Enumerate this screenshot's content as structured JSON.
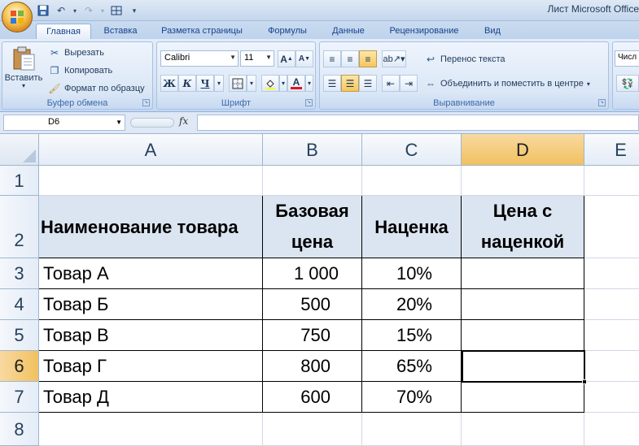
{
  "window": {
    "title": "Лист Microsoft Office"
  },
  "qat": {
    "save_icon": "save-icon",
    "undo_icon": "undo-icon",
    "redo_icon": "redo-icon"
  },
  "tabs": [
    {
      "label": "Главная",
      "active": true
    },
    {
      "label": "Вставка"
    },
    {
      "label": "Разметка страницы"
    },
    {
      "label": "Формулы"
    },
    {
      "label": "Данные"
    },
    {
      "label": "Рецензирование"
    },
    {
      "label": "Вид"
    }
  ],
  "ribbon": {
    "clipboard": {
      "label": "Буфер обмена",
      "paste": "Вставить",
      "cut": "Вырезать",
      "copy": "Копировать",
      "format_painter": "Формат по образцу"
    },
    "font": {
      "label": "Шрифт",
      "name": "Calibri",
      "size": "11",
      "bold": "Ж",
      "italic": "К",
      "underline": "Ч"
    },
    "alignment": {
      "label": "Выравнивание",
      "wrap_text": "Перенос текста",
      "merge_center": "Объединить и поместить в центре"
    },
    "number": {
      "format": "Числ"
    }
  },
  "formula_bar": {
    "name_box": "D6",
    "fx": "fx",
    "formula": ""
  },
  "sheet": {
    "columns": [
      "A",
      "B",
      "C",
      "D",
      "E"
    ],
    "selected_column": "D",
    "selected_row": "6",
    "rows": [
      "1",
      "2",
      "3",
      "4",
      "5",
      "6",
      "7",
      "8"
    ],
    "table_header": {
      "name": "Наименование товара",
      "base_price_1": "Базовая",
      "base_price_2": "цена",
      "markup": "Наценка",
      "price_with_markup_1": "Цена с",
      "price_with_markup_2": "наценкой"
    },
    "items": [
      {
        "name": "Товар А",
        "price": "1 000",
        "markup": "10%",
        "total": ""
      },
      {
        "name": "Товар Б",
        "price": "500",
        "markup": "20%",
        "total": ""
      },
      {
        "name": "Товар В",
        "price": "750",
        "markup": "15%",
        "total": ""
      },
      {
        "name": "Товар Г",
        "price": "800",
        "markup": "65%",
        "total": ""
      },
      {
        "name": "Товар Д",
        "price": "600",
        "markup": "70%",
        "total": ""
      }
    ]
  }
}
